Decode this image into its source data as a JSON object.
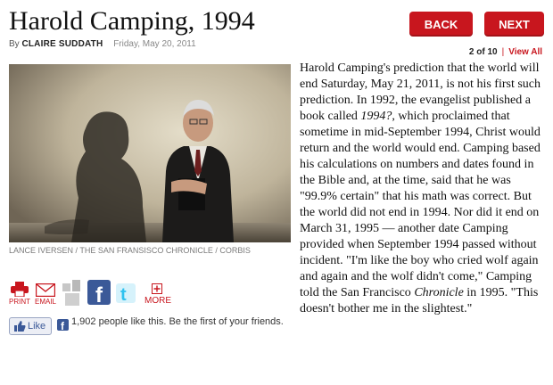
{
  "article": {
    "title": "Harold Camping, 1994",
    "byline_prefix": "By",
    "author": "CLAIRE SUDDATH",
    "date": "Friday, May 20, 2011",
    "photo_credit": "LANCE IVERSEN / THE SAN FRANSISCO CHRONICLE / CORBIS",
    "body": {
      "p1": "Harold Camping's prediction that the world will end Saturday, May 21, 2011, is not his first such prediction. In 1992, the evangelist published a book called ",
      "book_title": "1994?",
      "p2": ", which proclaimed that sometime in mid-September 1994, Christ would return and the world would end. Camping based his calculations on numbers and dates found in the Bible and, at the time, said that he was \"99.9% certain\" that his math was correct. But the world did not end in 1994. Nor did it end on March 31, 1995 — another date Camping provided when September 1994 passed without incident. \"I'm like the boy who cried wolf again and again and the wolf didn't come,\" Camping told the San Francisco ",
      "paper_name": "Chronicle",
      "p3": " in 1995. \"This doesn't bother me in the slightest.\""
    }
  },
  "nav": {
    "back_label": "BACK",
    "next_label": "NEXT",
    "page_count": "2 of 10",
    "view_all": "View All"
  },
  "share": {
    "print_label": "PRINT",
    "email_label": "EMAIL",
    "more_label": "MORE"
  },
  "facebook": {
    "like_label": "Like",
    "like_text": "1,902 people like this. Be the first of your friends."
  },
  "colors": {
    "accent": "#c8161e",
    "facebook": "#3b5998",
    "twitter": "#2fc2ef"
  }
}
